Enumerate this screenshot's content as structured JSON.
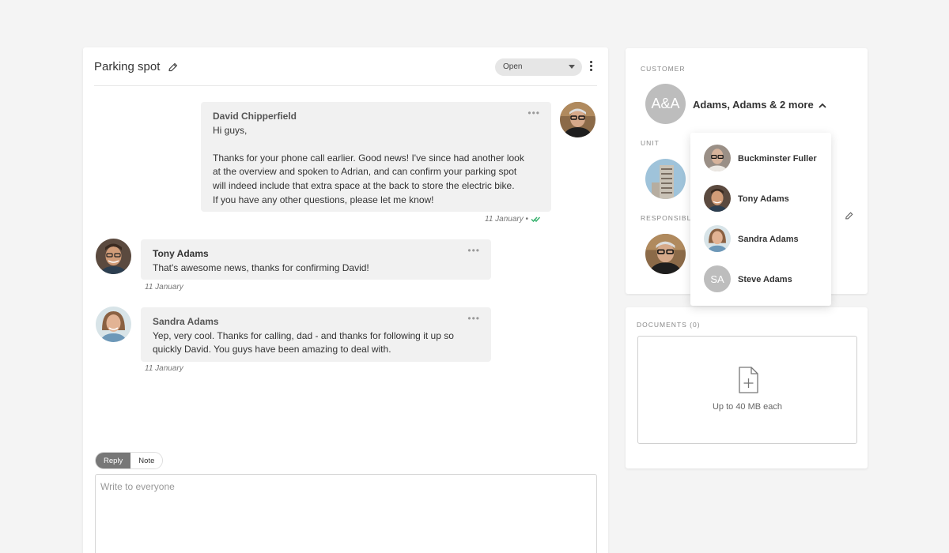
{
  "conversation": {
    "title": "Parking spot",
    "status": "Open"
  },
  "messages": [
    {
      "author": "David Chipperfield",
      "lines": [
        "Hi guys,",
        "",
        "Thanks for your phone call earlier. Good news! I've since had another look",
        "at the overview and spoken to Adrian, and can confirm your parking spot",
        "will indeed include that extra space at the back to store the electric bike.",
        "If you have any other questions, please let me know!"
      ],
      "date": "11 January",
      "separator": "•"
    },
    {
      "author": "Tony Adams",
      "lines": [
        "That's awesome news, thanks for confirming David!"
      ],
      "date": "11 January"
    },
    {
      "author": "Sandra Adams",
      "lines": [
        "Yep, very cool. Thanks for calling, dad - and thanks for following it up so",
        "quickly David. You guys have been amazing to deal with."
      ],
      "date": "11 January"
    }
  ],
  "more_glyph": "•••",
  "reply": {
    "tab_reply": "Reply",
    "tab_note": "Note",
    "placeholder": "Write to everyone"
  },
  "customer": {
    "section_label": "CUSTOMER",
    "avatar_initials": "A&A",
    "name": "Adams, Adams & 2 more",
    "unit_label": "UNIT",
    "responsible_label": "RESPONSIBLE",
    "members": [
      {
        "name": "Buckminster Fuller"
      },
      {
        "name": "Tony Adams"
      },
      {
        "name": "Sandra Adams"
      },
      {
        "name": "Steve Adams",
        "initials": "SA"
      }
    ]
  },
  "documents": {
    "label": "DOCUMENTS (0)",
    "upload_hint": "Up to 40 MB each"
  },
  "colors": {
    "check": "#3cb371",
    "avatar_gray": "#bdbdbd"
  }
}
